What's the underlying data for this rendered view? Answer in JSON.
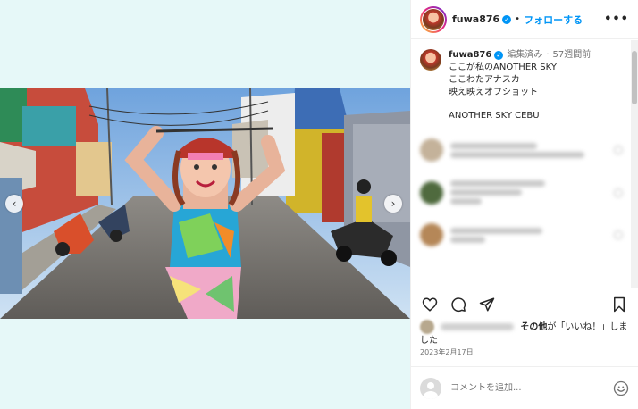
{
  "post": {
    "username": "fuwa876",
    "follow_label": "フォローする",
    "separator": "•"
  },
  "caption": {
    "username": "fuwa876",
    "edited": "編集済み",
    "separator": "·",
    "age": "57週間前",
    "lines": [
      "ここが私のANOTHER SKY",
      "ここわたアナスカ",
      "映え映えオフショット",
      "ANOTHER SKY CEBU"
    ]
  },
  "likes": {
    "prefix": "その他",
    "text": "が「いいね！」しました"
  },
  "date": "2023年2月17日",
  "comment_box": {
    "placeholder": "コメントを追加..."
  },
  "colors": {
    "accent": "#0095f6",
    "background": "#e6f8f8"
  },
  "icons": [
    "chevron-left-icon",
    "chevron-right-icon",
    "heart-icon",
    "comment-icon",
    "share-icon",
    "bookmark-icon",
    "more-icon",
    "verified-icon",
    "emoji-icon",
    "user-icon"
  ]
}
